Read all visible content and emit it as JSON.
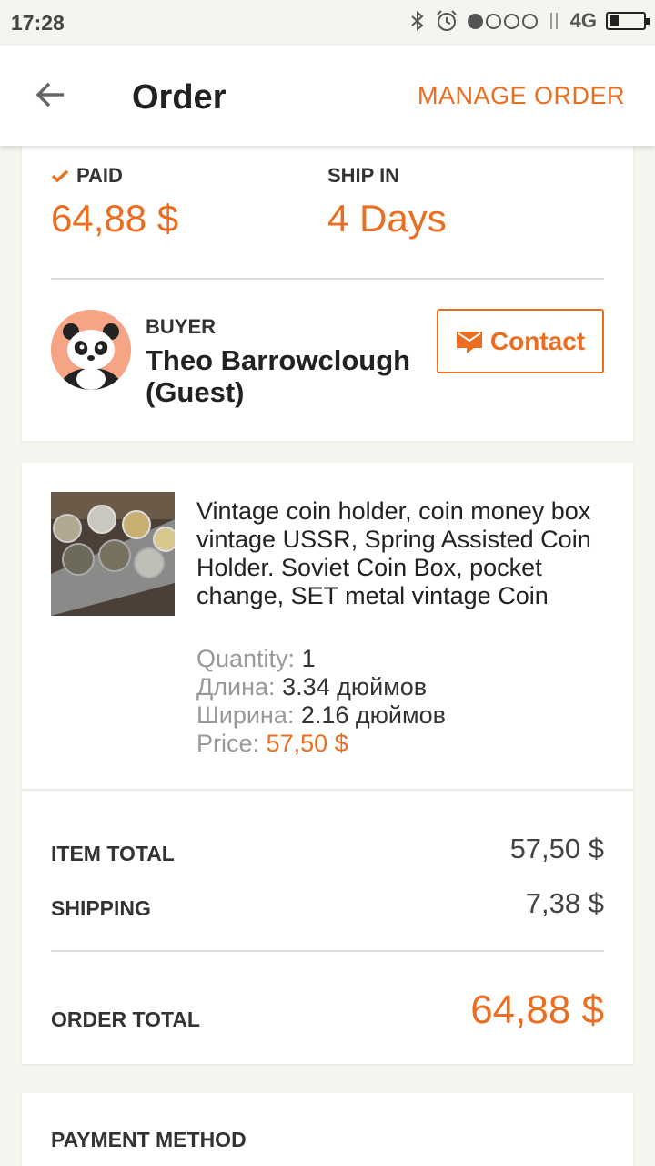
{
  "status_bar": {
    "time": "17:28",
    "network": "4G"
  },
  "header": {
    "title": "Order",
    "manage_label": "MANAGE ORDER"
  },
  "summary": {
    "paid_label": "PAID",
    "paid_amount": "64,88 $",
    "ship_label": "SHIP IN",
    "ship_value": "4 Days"
  },
  "buyer": {
    "label": "BUYER",
    "name": "Theo Barrowclough (Guest)",
    "contact_label": "Contact"
  },
  "item": {
    "title": "Vintage coin holder, coin money box vintage USSR, Spring Assisted Coin Holder. Soviet Coin Box, pocket change, SET metal vintage Coin",
    "attributes": [
      {
        "label": "Quantity:",
        "value": "1"
      },
      {
        "label": "Длина:",
        "value": "3.34 дюймов"
      },
      {
        "label": "Ширина:",
        "value": "2.16 дюймов"
      },
      {
        "label": "Price:",
        "value": "57,50 $"
      }
    ]
  },
  "totals": {
    "item_total_label": "ITEM TOTAL",
    "item_total_value": "57,50 $",
    "shipping_label": "SHIPPING",
    "shipping_value": "7,38 $",
    "order_total_label": "ORDER TOTAL",
    "order_total_value": "64,88 $"
  },
  "payment": {
    "label": "PAYMENT METHOD"
  },
  "colors": {
    "accent": "#eb6d20",
    "background": "#f5f4ef"
  }
}
